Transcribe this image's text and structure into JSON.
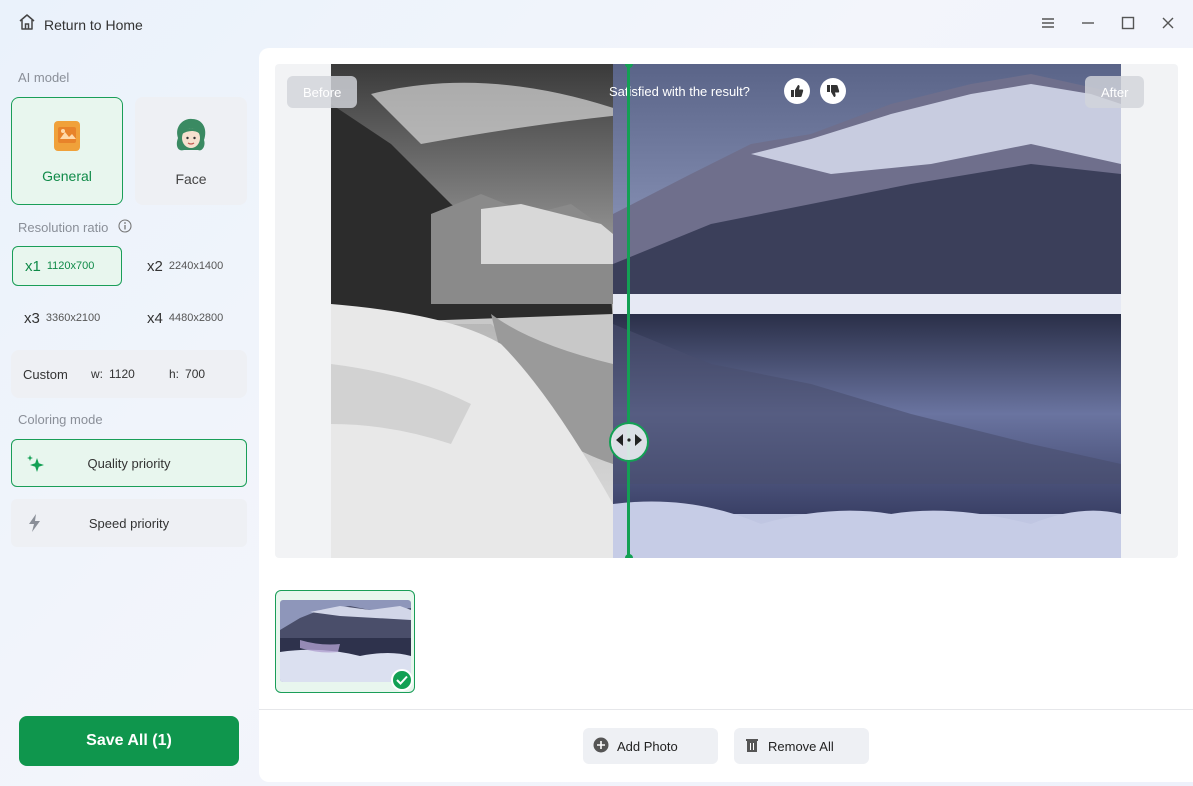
{
  "titlebar": {
    "home_label": "Return to Home",
    "home_icon": "home-icon",
    "controls": [
      "menu-icon",
      "minimize-icon",
      "maximize-icon",
      "close-icon"
    ]
  },
  "sidebar": {
    "ai_model_label": "AI model",
    "models": [
      {
        "label": "General",
        "active": true,
        "icon": "general-model-icon"
      },
      {
        "label": "Face",
        "active": false,
        "icon": "face-model-icon"
      }
    ],
    "resolution_label": "Resolution ratio",
    "resolutions": [
      {
        "mult": "x1",
        "dim": "1120x700",
        "active": true
      },
      {
        "mult": "x2",
        "dim": "2240x1400",
        "active": false
      },
      {
        "mult": "x3",
        "dim": "3360x2100",
        "active": false
      },
      {
        "mult": "x4",
        "dim": "4480x2800",
        "active": false
      }
    ],
    "custom": {
      "label": "Custom",
      "w_label": "w:",
      "w_value": "1120",
      "h_label": "h:",
      "h_value": "700"
    },
    "coloring_label": "Coloring mode",
    "modes": [
      {
        "label": "Quality priority",
        "active": true,
        "icon": "sparkle-icon"
      },
      {
        "label": "Speed priority",
        "active": false,
        "icon": "lightning-icon"
      }
    ],
    "save_label": "Save All (1)"
  },
  "preview": {
    "before_label": "Before",
    "after_label": "After",
    "satisfied_text": "Satisfied with the result?",
    "thumbs_up": "thumbs-up-icon",
    "thumbs_down": "thumbs-down-icon"
  },
  "actions": {
    "add_photo": "Add Photo",
    "remove_all": "Remove All"
  },
  "colors": {
    "accent": "#0f964d",
    "accent_light": "#e8f6ee"
  }
}
